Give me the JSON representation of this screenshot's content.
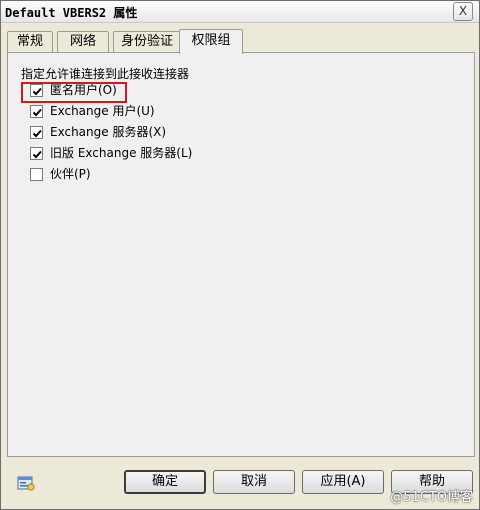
{
  "window": {
    "title": "Default VBERS2 属性",
    "close_label": "X"
  },
  "tabs": [
    {
      "label": "常规"
    },
    {
      "label": "网络"
    },
    {
      "label": "身份验证"
    },
    {
      "label": "权限组"
    }
  ],
  "permissions": {
    "intro": "指定允许谁连接到此接收连接器",
    "options": [
      {
        "label": "匿名用户(O)",
        "checked": true
      },
      {
        "label": "Exchange 用户(U)",
        "checked": true
      },
      {
        "label": "Exchange 服务器(X)",
        "checked": true
      },
      {
        "label": "旧版 Exchange 服务器(L)",
        "checked": true
      },
      {
        "label": "伙伴(P)",
        "checked": false
      }
    ]
  },
  "buttons": {
    "ok": "确定",
    "cancel": "取消",
    "apply": "应用(A)",
    "help": "帮助"
  },
  "watermark": "@51CTO博客",
  "icons": {
    "close": "close-icon",
    "check": "check-icon",
    "help_context": "properties-icon"
  },
  "colors": {
    "highlight": "#d0181e"
  }
}
